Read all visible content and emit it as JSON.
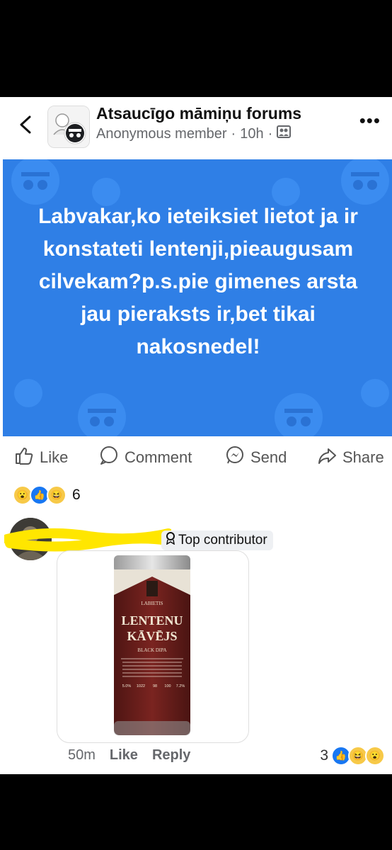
{
  "header": {
    "group_name": "Atsaucīgo māmiņu forums",
    "author": "Anonymous member",
    "separator": "·",
    "time": "10h"
  },
  "post": {
    "text": "Labvakar,ko ieteiksiet lietot ja ir konstateti lentenji,pieaugusam cilvekam?p.s.pie gimenes arsta jau pieraksts ir,bet tikai nakosnedel!",
    "background_color": "#2f7fe6"
  },
  "actions": {
    "like": "Like",
    "comment": "Comment",
    "send": "Send",
    "share": "Share"
  },
  "reactions": {
    "count": "6",
    "types": [
      "wow",
      "like",
      "haha"
    ]
  },
  "comment": {
    "badge": "Top contributor",
    "time": "50m",
    "like": "Like",
    "reply": "Reply",
    "reaction_count": "3",
    "reaction_types": [
      "like",
      "haha",
      "wow"
    ],
    "media": {
      "brand": "LABIETIS",
      "line1": "LENTENU",
      "line2": "KĀVĒJS",
      "style": "BLACK DIPA",
      "stats": [
        "5.0%",
        "1022",
        "98",
        "100",
        "7.2%"
      ]
    }
  }
}
